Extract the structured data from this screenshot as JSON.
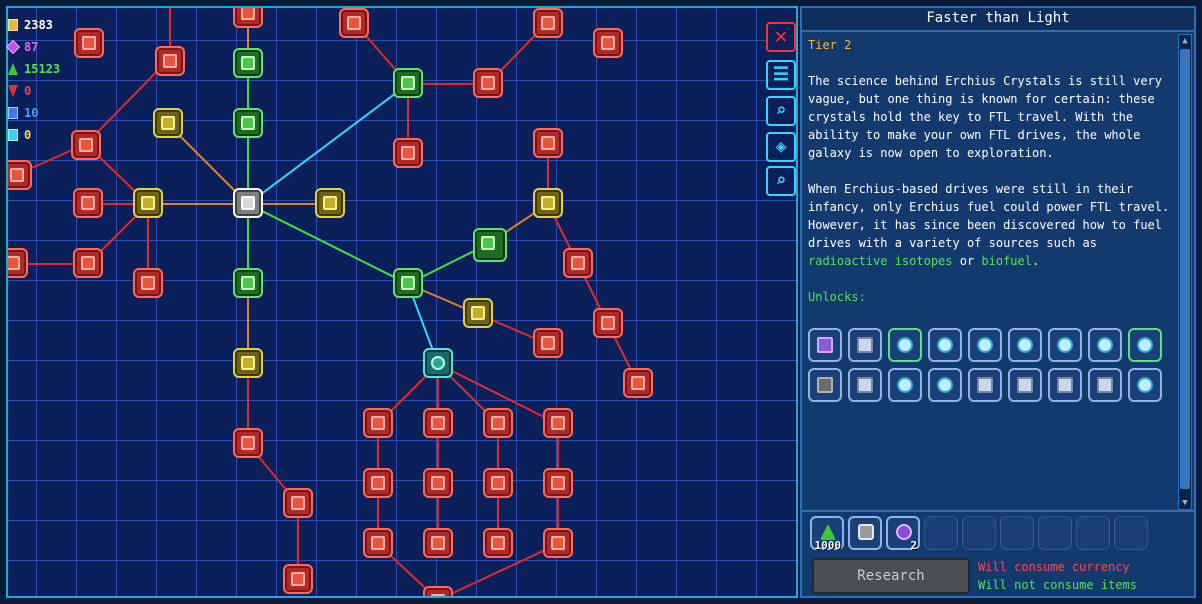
{
  "resources": {
    "money": "2383",
    "pixels": "87",
    "research": "15123",
    "red": "0",
    "blue": "10",
    "yellow": "0"
  },
  "side_buttons": {
    "close": "✕",
    "list": "☰",
    "search": "⌕",
    "locate": "◈",
    "zoom": "⌕"
  },
  "detail": {
    "title": "Faster than Light",
    "tier": "Tier 2",
    "paragraph1": "The science behind Erchius Crystals is still very vague, but one thing is known for certain: these crystals hold the key to FTL travel. With the ability to make your own FTL drives, the whole galaxy is now open to exploration.",
    "paragraph2_a": "When Erchius-based drives were still in their infancy, only Erchius fuel could power FTL travel. However, it has since been discovered how to fuel drives with a variety of sources such as ",
    "link1": "radioactive isotopes",
    "paragraph2_b": " or ",
    "link2": "biofuel",
    "paragraph2_c": ".",
    "unlocks_label": "Unlocks:",
    "unlocks": [
      {
        "icon": "hat-icon",
        "style": "hat"
      },
      {
        "icon": "machine-icon",
        "style": "device"
      },
      {
        "icon": "orb-icon",
        "style": "green"
      },
      {
        "icon": "orb-icon",
        "style": ""
      },
      {
        "icon": "orb-icon",
        "style": ""
      },
      {
        "icon": "orb-icon",
        "style": ""
      },
      {
        "icon": "orb-icon",
        "style": ""
      },
      {
        "icon": "orb-icon",
        "style": ""
      },
      {
        "icon": "orb-icon",
        "style": "green"
      },
      {
        "icon": "tile-icon",
        "style": "tile"
      },
      {
        "icon": "lamp-icon",
        "style": "device"
      },
      {
        "icon": "orb-icon",
        "style": ""
      },
      {
        "icon": "orb-icon",
        "style": ""
      },
      {
        "icon": "console-icon",
        "style": "device"
      },
      {
        "icon": "panel-icon",
        "style": "device"
      },
      {
        "icon": "panel-icon",
        "style": "device"
      },
      {
        "icon": "panel-icon",
        "style": "device"
      },
      {
        "icon": "orb-icon",
        "style": ""
      }
    ]
  },
  "costs": [
    {
      "icon": "research-flask-icon",
      "count": "1000"
    },
    {
      "icon": "ore-chunk-icon",
      "count": ""
    },
    {
      "icon": "erchius-crystal-icon",
      "count": "2"
    },
    {
      "icon": "empty-slot",
      "count": ""
    },
    {
      "icon": "empty-slot",
      "count": ""
    },
    {
      "icon": "empty-slot",
      "count": ""
    },
    {
      "icon": "empty-slot",
      "count": ""
    },
    {
      "icon": "empty-slot",
      "count": ""
    },
    {
      "icon": "empty-slot",
      "count": ""
    }
  ],
  "research_button": "Research",
  "consume_currency": "Will consume currency",
  "consume_items": "Will not consume items",
  "tree": {
    "nodes": [
      {
        "id": "n0",
        "style": "olive"
      },
      {
        "id": "n1",
        "style": "green"
      },
      {
        "id": "n2",
        "style": "green"
      },
      {
        "id": "n3",
        "style": "gray"
      },
      {
        "id": "n4",
        "style": "olive"
      },
      {
        "id": "n5",
        "style": "olive"
      },
      {
        "id": "n6",
        "style": "green"
      },
      {
        "id": "n7",
        "style": "green"
      },
      {
        "id": "n8",
        "style": "green"
      },
      {
        "id": "n9",
        "style": "teal"
      },
      {
        "id": "n10",
        "style": "olive"
      },
      {
        "id": "n11",
        "style": "green"
      },
      {
        "id": "n12",
        "style": "olive"
      },
      {
        "id": "n13",
        "style": "red"
      },
      {
        "id": "n14",
        "style": "red"
      }
    ]
  }
}
